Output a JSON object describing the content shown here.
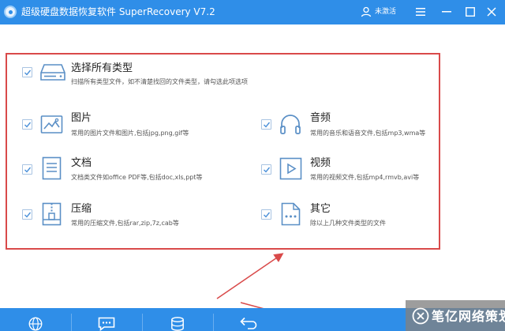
{
  "window": {
    "title": "超级硬盘数据恢复软件 SuperRecovery V7.2",
    "user_label": "未激活",
    "accent_color": "#2f8ee8",
    "controls": [
      "user-icon",
      "menu-icon",
      "minimize-icon",
      "close-icon"
    ]
  },
  "select_all": {
    "title": "选择所有类型",
    "description": "扫描所有类型文件，如不清楚找回的文件类型，请勾选此项选项",
    "checked": true
  },
  "file_types": [
    {
      "title": "图片",
      "description": "常用的图片文件和图片,包括jpg,png,gif等",
      "icon": "image-icon",
      "checked": true
    },
    {
      "title": "音频",
      "description": "常用的音乐和语音文件,包括mp3,wma等",
      "icon": "headphones-icon",
      "checked": true
    },
    {
      "title": "文档",
      "description": "文档类文件如office PDF等,包括doc,xls,ppt等",
      "icon": "document-icon",
      "checked": true
    },
    {
      "title": "视频",
      "description": "常用的视频文件,包括mp4,rmvb,avi等",
      "icon": "video-icon",
      "checked": true
    },
    {
      "title": "压缩",
      "description": "常用的压缩文件,包括rar,zip,7z,cab等",
      "icon": "archive-icon",
      "checked": true
    },
    {
      "title": "其它",
      "description": "除以上几种文件类型的文件",
      "icon": "other-files-icon",
      "checked": true
    }
  ],
  "bottom_toolbar": {
    "icons": [
      "globe-icon",
      "chat-icon",
      "database-icon",
      "back-arrow-icon"
    ]
  },
  "annotation": {
    "highlight_color": "#d94a4a"
  },
  "watermark": {
    "text": "笔亿网络策划"
  }
}
